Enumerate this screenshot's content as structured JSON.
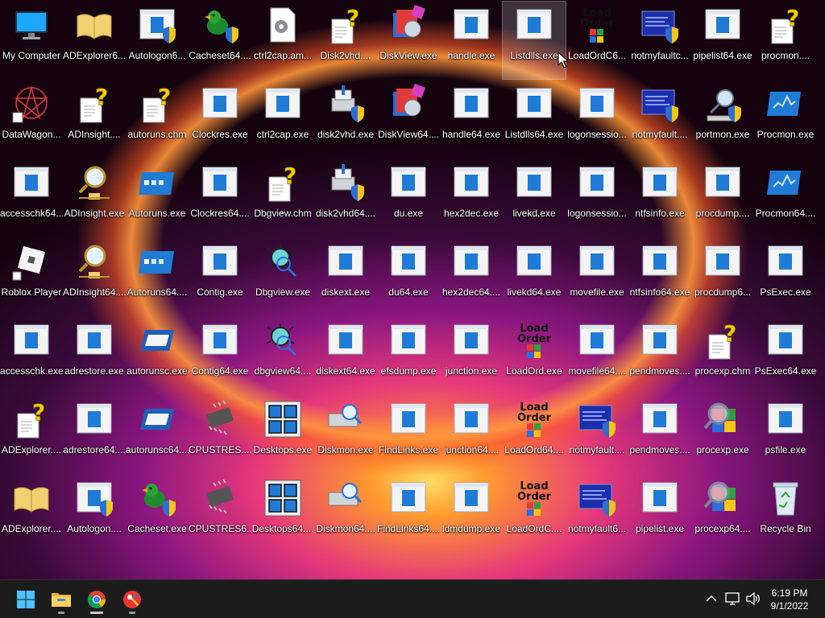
{
  "desktop": {
    "icons": [
      {
        "label": "My Computer",
        "icon": "monitor-icon"
      },
      {
        "label": "ADExplorer6...",
        "icon": "book-icon"
      },
      {
        "label": "Autologon6...",
        "icon": "window-shield-icon"
      },
      {
        "label": "Cacheset64....",
        "icon": "duck-shield-icon"
      },
      {
        "label": "ctrl2cap.am...",
        "icon": "gear-file-icon"
      },
      {
        "label": "Disk2vhd....",
        "icon": "help-file-icon"
      },
      {
        "label": "DiskView.exe",
        "icon": "diskview-icon"
      },
      {
        "label": "handle.exe",
        "icon": "app-window-icon"
      },
      {
        "label": "Listdlls.exe",
        "icon": "app-window-icon"
      },
      {
        "label": "LoadOrdC6...",
        "icon": "loadorder-icon"
      },
      {
        "label": "notmyfaultc...",
        "icon": "bsod-shield-icon"
      },
      {
        "label": "pipelist64.exe",
        "icon": "app-window-icon"
      },
      {
        "label": "procmon....",
        "icon": "help-file-icon"
      },
      {
        "label": "DataWagon...",
        "icon": "datawagon-icon"
      },
      {
        "label": "ADInsight....",
        "icon": "help-file-icon"
      },
      {
        "label": "autoruns.chm",
        "icon": "help-file-icon"
      },
      {
        "label": "Clockres.exe",
        "icon": "app-window-icon"
      },
      {
        "label": "ctrl2cap.exe",
        "icon": "app-window-icon"
      },
      {
        "label": "disk2vhd.exe",
        "icon": "disk-shield-icon"
      },
      {
        "label": "DiskView64....",
        "icon": "diskview-icon"
      },
      {
        "label": "handle64.exe",
        "icon": "app-window-icon"
      },
      {
        "label": "Listdlls64.exe",
        "icon": "app-window-icon"
      },
      {
        "label": "logonsessio...",
        "icon": "app-window-icon"
      },
      {
        "label": "notmyfault....",
        "icon": "bsod-shield-icon"
      },
      {
        "label": "portmon.exe",
        "icon": "portmon-icon"
      },
      {
        "label": "Procmon.exe",
        "icon": "procmon-icon"
      },
      {
        "label": "accesschk64....",
        "icon": "app-window-icon"
      },
      {
        "label": "ADInsight.exe",
        "icon": "magnifier-network-icon"
      },
      {
        "label": "Autoruns.exe",
        "icon": "autoruns-icon"
      },
      {
        "label": "Clockres64....",
        "icon": "app-window-icon"
      },
      {
        "label": "Dbgview.chm",
        "icon": "help-file-icon"
      },
      {
        "label": "disk2vhd64....",
        "icon": "disk-shield-icon"
      },
      {
        "label": "du.exe",
        "icon": "app-window-icon"
      },
      {
        "label": "hex2dec.exe",
        "icon": "app-window-icon"
      },
      {
        "label": "livekd.exe",
        "icon": "app-window-icon"
      },
      {
        "label": "logonsessio...",
        "icon": "app-window-icon"
      },
      {
        "label": "ntfsinfo.exe",
        "icon": "app-window-icon"
      },
      {
        "label": "procdump....",
        "icon": "app-window-icon"
      },
      {
        "label": "Procmon64....",
        "icon": "procmon-icon"
      },
      {
        "label": "Roblox Player",
        "icon": "roblox-icon"
      },
      {
        "label": "ADInsight64....",
        "icon": "magnifier-network-icon"
      },
      {
        "label": "Autoruns64....",
        "icon": "autoruns-icon"
      },
      {
        "label": "Contig.exe",
        "icon": "app-window-icon"
      },
      {
        "label": "Dbgview.exe",
        "icon": "bug-magnifier-icon"
      },
      {
        "label": "diskext.exe",
        "icon": "app-window-icon"
      },
      {
        "label": "du64.exe",
        "icon": "app-window-icon"
      },
      {
        "label": "hex2dec64....",
        "icon": "app-window-icon"
      },
      {
        "label": "livekd64.exe",
        "icon": "app-window-icon"
      },
      {
        "label": "movefile.exe",
        "icon": "app-window-icon"
      },
      {
        "label": "ntfsinfo64.exe",
        "icon": "app-window-icon"
      },
      {
        "label": "procdump6...",
        "icon": "app-window-icon"
      },
      {
        "label": "PsExec.exe",
        "icon": "app-window-icon"
      },
      {
        "label": "accesschk.exe",
        "icon": "app-window-icon"
      },
      {
        "label": "adrestore.exe",
        "icon": "app-window-icon"
      },
      {
        "label": "autorunsc.exe",
        "icon": "autorunsc-icon"
      },
      {
        "label": "Contig64.exe",
        "icon": "app-window-icon"
      },
      {
        "label": "dbgview64....",
        "icon": "bug-magnifier-icon"
      },
      {
        "label": "diskext64.exe",
        "icon": "app-window-icon"
      },
      {
        "label": "efsdump.exe",
        "icon": "app-window-icon"
      },
      {
        "label": "junction.exe",
        "icon": "app-window-icon"
      },
      {
        "label": "LoadOrd.exe",
        "icon": "loadorder-icon"
      },
      {
        "label": "movefile64....",
        "icon": "app-window-icon"
      },
      {
        "label": "pendmoves....",
        "icon": "app-window-icon"
      },
      {
        "label": "procexp.chm",
        "icon": "help-file-icon"
      },
      {
        "label": "PsExec64.exe",
        "icon": "app-window-icon"
      },
      {
        "label": "ADExplorer....",
        "icon": "help-file-icon"
      },
      {
        "label": "adrestore64....",
        "icon": "app-window-icon"
      },
      {
        "label": "autorunsc64....",
        "icon": "autorunsc-icon"
      },
      {
        "label": "CPUSTRES....",
        "icon": "chip-icon"
      },
      {
        "label": "Desktops.exe",
        "icon": "desktops-icon"
      },
      {
        "label": "Diskmon.exe",
        "icon": "diskmon-icon"
      },
      {
        "label": "FindLinks.exe",
        "icon": "app-window-icon"
      },
      {
        "label": "junction64....",
        "icon": "app-window-icon"
      },
      {
        "label": "LoadOrd64....",
        "icon": "loadorder-icon"
      },
      {
        "label": "notmyfault....",
        "icon": "bsod-shield-icon"
      },
      {
        "label": "pendmoves....",
        "icon": "app-window-icon"
      },
      {
        "label": "procexp.exe",
        "icon": "procexp-icon"
      },
      {
        "label": "psfile.exe",
        "icon": "app-window-icon"
      },
      {
        "label": "ADExplorer....",
        "icon": "book-icon"
      },
      {
        "label": "Autologon....",
        "icon": "window-shield-icon"
      },
      {
        "label": "Cacheset.exe",
        "icon": "duck-shield-icon"
      },
      {
        "label": "CPUSTRES6...",
        "icon": "chip-icon"
      },
      {
        "label": "Desktops64....",
        "icon": "desktops-icon"
      },
      {
        "label": "Diskmon64....",
        "icon": "diskmon-icon"
      },
      {
        "label": "FindLinks64....",
        "icon": "app-window-icon"
      },
      {
        "label": "ldmdump.exe",
        "icon": "app-window-icon"
      },
      {
        "label": "LoadOrdC....",
        "icon": "loadorder-icon"
      },
      {
        "label": "notmyfault6...",
        "icon": "bsod-shield-icon"
      },
      {
        "label": "pipelist.exe",
        "icon": "app-window-icon"
      },
      {
        "label": "procexp64....",
        "icon": "procexp-icon"
      },
      {
        "label": "Recycle Bin",
        "icon": "recycle-bin-icon"
      }
    ],
    "selected_index": 8
  },
  "loadorder_text": [
    "Load",
    "Order"
  ],
  "taskbar": {
    "items": [
      {
        "name": "start-button",
        "icon": "windows-logo-icon"
      },
      {
        "name": "file-explorer-button",
        "icon": "folder-icon",
        "running": true
      },
      {
        "name": "chrome-button",
        "icon": "chrome-icon",
        "running": true,
        "active": true
      },
      {
        "name": "paint-app-button",
        "icon": "paint-icon",
        "running": true
      }
    ],
    "tray": [
      "chevron-up-icon",
      "network-icon",
      "volume-icon"
    ],
    "clock": {
      "time": "6:19 PM",
      "date": "9/1/2022"
    }
  },
  "colors": {
    "taskbar": "#1c1c1c",
    "accent": "#1a73e8",
    "window_icon_blue": "#1f7bd6"
  }
}
